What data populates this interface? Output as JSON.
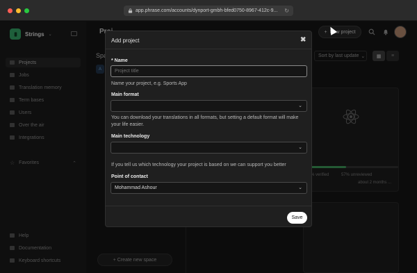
{
  "browser": {
    "url": "app.phrase.com/accounts/dynport-gmbh-bfed0750-8967-412c-9..."
  },
  "sidebar": {
    "app_name": "Strings",
    "items": [
      {
        "label": "Projects",
        "icon": "folder-icon"
      },
      {
        "label": "Jobs",
        "icon": "briefcase-icon"
      },
      {
        "label": "Translation memory",
        "icon": "memory-icon"
      },
      {
        "label": "Term bases",
        "icon": "book-icon"
      },
      {
        "label": "Users",
        "icon": "users-icon"
      },
      {
        "label": "Over the air",
        "icon": "cloud-icon"
      },
      {
        "label": "Integrations",
        "icon": "plug-icon"
      }
    ],
    "favorites_label": "Favorites",
    "bottom": [
      {
        "label": "Help",
        "icon": "help-icon"
      },
      {
        "label": "Documentation",
        "icon": "doc-icon"
      },
      {
        "label": "Keyboard shortcuts",
        "icon": "keyboard-icon"
      }
    ]
  },
  "main": {
    "title": "Proj",
    "spaces_label": "Spa",
    "spaces_chip": "A",
    "new_project_label": "New project",
    "sort_label": "Sort by last update",
    "create_space_label": "+ Create new space",
    "card": {
      "status_left": "% verified",
      "status_right": "57% unreviewed",
      "updated": "about 2 months ...",
      "progress": 0.42
    }
  },
  "modal": {
    "title": "Add project",
    "name_label": "* Name",
    "name_placeholder": "Project title",
    "name_help": "Name your project, e.g. Sports App",
    "format_label": "Main format",
    "format_help": "You can download your translations in all formats, but setting a default format will make your life easier.",
    "technology_label": "Main technology",
    "technology_help": "If you tell us which technology your project is based on we can support you better",
    "contact_label": "Point of contact",
    "contact_value": "Mohammad Ashour",
    "save_label": "Save"
  },
  "colors": {
    "accent_green": "#35a466",
    "progress_green": "#3e9b5a"
  }
}
